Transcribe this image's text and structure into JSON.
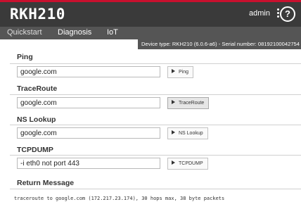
{
  "header": {
    "logo": "RKH210",
    "user": "admin",
    "help_label": "?"
  },
  "tabs": [
    {
      "label": "Quickstart",
      "active": true
    },
    {
      "label": "Diagnosis",
      "active": false
    },
    {
      "label": "IoT",
      "active": false
    }
  ],
  "device_info": "Device type: RKH210 (6.0.6-a6) - Serial number: 08192100042754",
  "sections": {
    "ping": {
      "title": "Ping",
      "value": "google.com",
      "button": "Ping"
    },
    "traceroute": {
      "title": "TraceRoute",
      "value": "google.com",
      "button": "TraceRoute"
    },
    "nslookup": {
      "title": "NS Lookup",
      "value": "google.com",
      "button": "NS Lookup"
    },
    "tcpdump": {
      "title": "TCPDUMP",
      "value": "-i eth0 not port 443",
      "button": "TCPDUMP"
    }
  },
  "return_message": {
    "title": "Return Message",
    "text": "traceroute to google.com (172.217.23.174), 30 hops max, 38 byte packets"
  },
  "colors": {
    "topbar": "#3a3a3a",
    "accent": "#c8102e",
    "tabbar": "#555555"
  }
}
